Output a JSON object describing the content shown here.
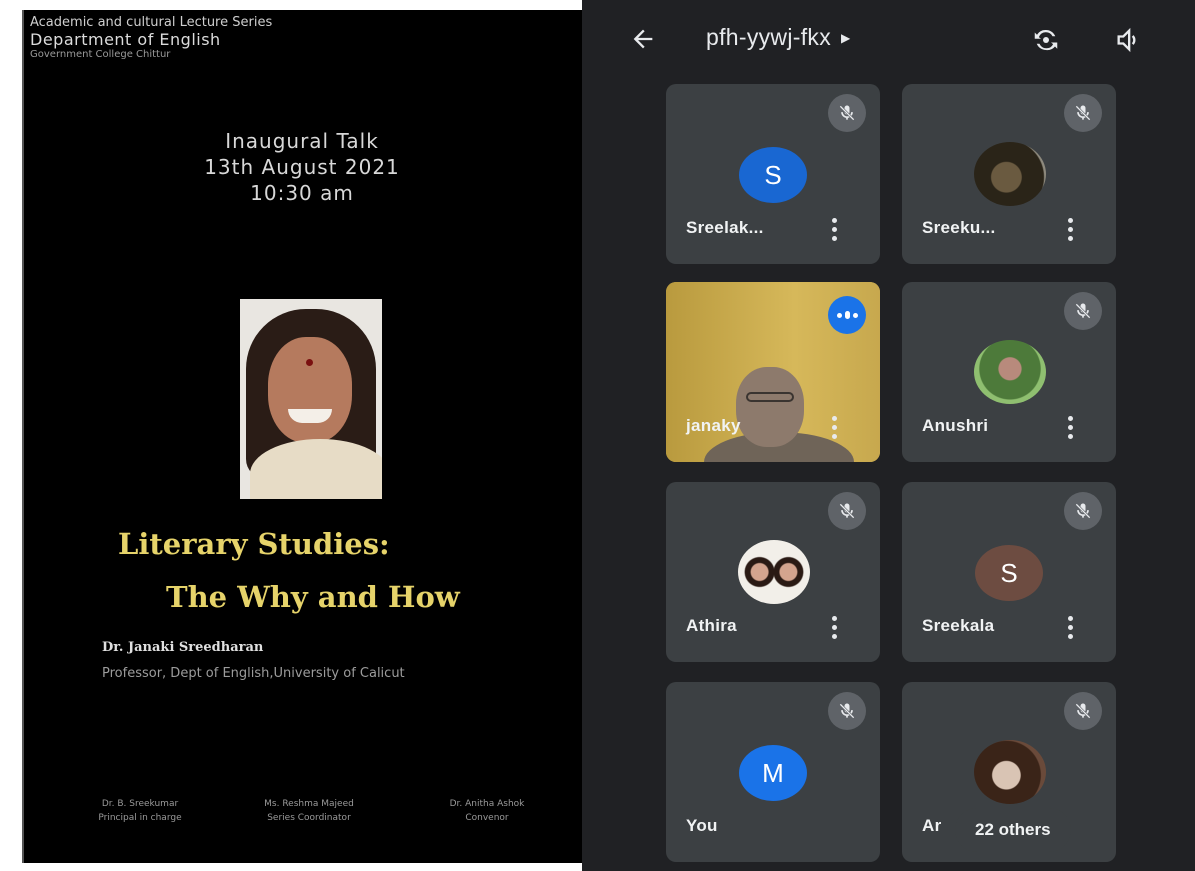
{
  "poster": {
    "series": "Academic and cultural Lecture Series",
    "department": "Department of English",
    "college": "Government College Chittur",
    "talk_title": "Inaugural Talk",
    "date": "13th August 2021",
    "time": "10:30 am",
    "lecture_title_line1": "Literary Studies:",
    "lecture_title_line2": "The Why and How",
    "speaker_name": "Dr. Janaki Sreedharan",
    "speaker_affiliation": "Professor, Dept of English,University of Calicut",
    "coordinators": [
      {
        "name": "Dr. B. Sreekumar",
        "role": "Principal in charge"
      },
      {
        "name": "Ms. Reshma Majeed",
        "role": "Series Coordinator"
      },
      {
        "name": "Dr. Anitha Ashok",
        "role": "Convenor"
      }
    ]
  },
  "meet": {
    "meeting_code": "pfh-yywj-fkx",
    "icons": {
      "back": "arrow-left-icon",
      "switch_camera": "camera-switch-icon",
      "audio": "speaker-icon",
      "mic_off": "mic-off-icon",
      "more": "more-vert-icon",
      "speaking": "audio-level-icon"
    },
    "participants": [
      {
        "name": "Sreelak...",
        "avatar_type": "letter",
        "avatar_letter": "S",
        "avatar_color": "#1967d2",
        "muted": true
      },
      {
        "name": "Sreeku...",
        "avatar_type": "photo",
        "muted": true
      },
      {
        "name": "janaky",
        "avatar_type": "video",
        "speaking": true
      },
      {
        "name": "Anushri",
        "avatar_type": "photo",
        "muted": true
      },
      {
        "name": "Athira",
        "avatar_type": "photo",
        "muted": true
      },
      {
        "name": "Sreekala",
        "avatar_type": "letter",
        "avatar_letter": "S",
        "avatar_color": "#6d4c41",
        "muted": true
      },
      {
        "name": "You",
        "avatar_type": "letter",
        "avatar_letter": "M",
        "avatar_color": "#1a73e8",
        "muted": true
      },
      {
        "name": "Ar",
        "avatar_type": "photo",
        "muted": true
      }
    ],
    "others_label": "22 others"
  },
  "colors": {
    "meet_bg": "#202124",
    "tile_bg": "#3c4043",
    "mute_bg": "#5f6368",
    "accent_blue": "#1a73e8",
    "poster_title": "#e6d36a"
  }
}
